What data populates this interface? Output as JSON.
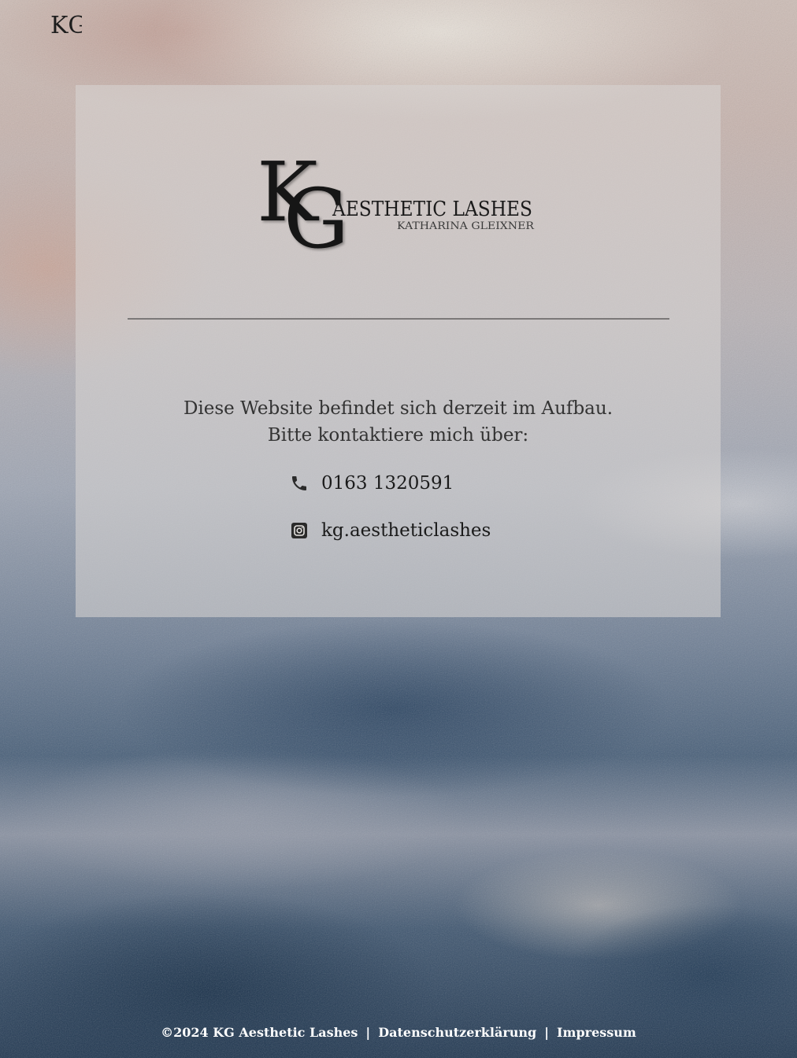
{
  "header": {
    "logo_small_monogram": "KG"
  },
  "card": {
    "logo": {
      "monogram": "KG",
      "brand_name": "AESTHETIC LASHES",
      "owner_name": "KATHARINA GLEIXNER"
    },
    "message": {
      "line1": "Diese Website befindet sich derzeit im Aufbau.",
      "line2": "Bitte kontaktiere mich über:"
    },
    "contacts": {
      "phone": {
        "icon": "phone-icon",
        "text": "0163 1320591"
      },
      "instagram": {
        "icon": "instagram-icon",
        "text": "kg.aestheticlashes"
      }
    }
  },
  "footer": {
    "copyright": "©2024 KG Aesthetic Lashes",
    "separator": "|",
    "privacy_label": "Datenschutzerklärung",
    "imprint_label": "Impressum"
  },
  "colors": {
    "text_dark": "#333333",
    "divider": "#7b7878",
    "footer_text": "#ffffff"
  }
}
